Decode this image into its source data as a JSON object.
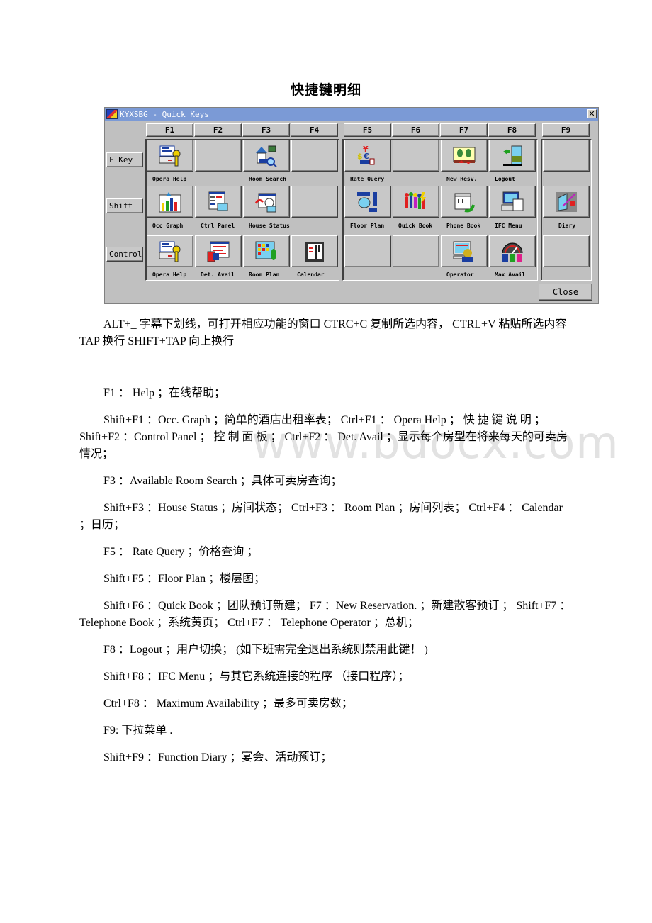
{
  "document": {
    "title": "快捷键明细",
    "watermark": "www.bdocx.com"
  },
  "dialog": {
    "window_title": "KYXSBG - Quick Keys",
    "close_x": "✕",
    "close_button": {
      "prefix": "C",
      "rest": "lose"
    },
    "fkeys": [
      "F1",
      "F2",
      "F3",
      "F4",
      "F5",
      "F6",
      "F7",
      "F8",
      "F9"
    ],
    "modifiers": [
      "F Key",
      "Shift",
      "Control"
    ],
    "rows": [
      {
        "row": "F Key",
        "cells": [
          {
            "key": "F1",
            "icon": "opera-help-icon",
            "label": "Opera Help"
          },
          {
            "key": "F2",
            "icon": "",
            "label": ""
          },
          {
            "key": "F3",
            "icon": "room-search-icon",
            "label": "Room Search"
          },
          {
            "key": "F4",
            "icon": "",
            "label": ""
          },
          {
            "key": "F5",
            "icon": "rate-query-icon",
            "label": "Rate Query"
          },
          {
            "key": "F6",
            "icon": "",
            "label": ""
          },
          {
            "key": "F7",
            "icon": "new-reservation-icon",
            "label": "New Resv."
          },
          {
            "key": "F8",
            "icon": "logout-icon",
            "label": "Logout"
          },
          {
            "key": "F9",
            "icon": "",
            "label": ""
          }
        ]
      },
      {
        "row": "Shift",
        "cells": [
          {
            "key": "F1",
            "icon": "occ-graph-icon",
            "label": "Occ Graph"
          },
          {
            "key": "F2",
            "icon": "ctrl-panel-icon",
            "label": "Ctrl Panel"
          },
          {
            "key": "F3",
            "icon": "house-status-icon",
            "label": "House Status"
          },
          {
            "key": "F4",
            "icon": "",
            "label": ""
          },
          {
            "key": "F5",
            "icon": "floor-plan-icon",
            "label": "Floor Plan"
          },
          {
            "key": "F6",
            "icon": "quick-book-icon",
            "label": "Quick Book"
          },
          {
            "key": "F7",
            "icon": "phone-book-icon",
            "label": "Phone Book"
          },
          {
            "key": "F8",
            "icon": "ifc-menu-icon",
            "label": "IFC Menu"
          },
          {
            "key": "F9",
            "icon": "diary-icon",
            "label": "Diary"
          }
        ]
      },
      {
        "row": "Control",
        "cells": [
          {
            "key": "F1",
            "icon": "opera-help-icon",
            "label": "Opera Help"
          },
          {
            "key": "F2",
            "icon": "det-avail-icon",
            "label": "Det. Avail"
          },
          {
            "key": "F3",
            "icon": "room-plan-icon",
            "label": "Room Plan"
          },
          {
            "key": "F4",
            "icon": "calendar-icon",
            "label": "Calendar"
          },
          {
            "key": "F5",
            "icon": "",
            "label": ""
          },
          {
            "key": "F6",
            "icon": "",
            "label": ""
          },
          {
            "key": "F7",
            "icon": "operator-icon",
            "label": "Operator"
          },
          {
            "key": "F8",
            "icon": "max-avail-icon",
            "label": "Max Avail"
          },
          {
            "key": "F9",
            "icon": "",
            "label": ""
          }
        ]
      }
    ]
  },
  "paragraphs": [
    "ALT+_ 字幕下划线，可打开相应功能的窗口 CTRC+C 复制所选内容， CTRL+V 粘贴所选内容 TAP 换行 SHIFT+TAP 向上换行",
    "F1 ： Help ；在线帮助；",
    "Shift+F1 ：Occ. Graph ；简单的酒店出租率表； Ctrl+F1 ： Opera Help ； 快 捷 键 说 明 ； Shift+F2 ：Control Panel ； 控 制 面 板 ； Ctrl+F2 ： Det. Avail ；显示每个房型在将来每天的可卖房情况；",
    "F3 ：Available Room Search ；具体可卖房查询；",
    "Shift+F3 ：House Status ；房间状态； Ctrl+F3 ： Room Plan ；房间列表； Ctrl+F4 ： Calendar ；日历；",
    "F5 ： Rate Query ；价格查询 ；",
    "Shift+F5 ：Floor Plan ；楼层图；",
    "Shift+F6 ：Quick Book ；团队预订新建； F7 ：New Reservation. ；新建散客预订 ； Shift+F7 ：Telephone Book ；系统黄页； Ctrl+F7 ： Telephone Operator ；总机；",
    "F8 ：Logout ；用户切换； (如下班需完全退出系统则禁用此键！ )",
    "Shift+F8 ：IFC Menu ；与其它系统连接的程序 （接口程序）；",
    "Ctrl+F8 ： Maximum Availability ；最多可卖房数；",
    "F9: 下拉菜单 .",
    "Shift+F9 ：Function Diary ；宴会、活动预订；"
  ]
}
